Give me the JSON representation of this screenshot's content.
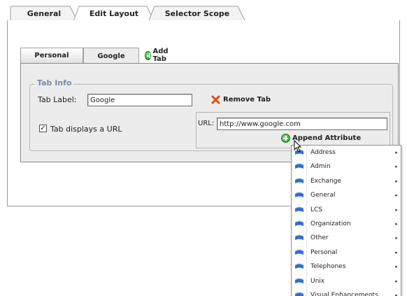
{
  "top_tabs": [
    {
      "label": "General",
      "active": false
    },
    {
      "label": "Edit Layout",
      "active": true
    },
    {
      "label": "Selector Scope",
      "active": false
    }
  ],
  "inner_tabs": [
    {
      "label": "Personal",
      "active": false
    },
    {
      "label": "Google",
      "active": true
    }
  ],
  "add_tab_label": "Add Tab",
  "tab_info": {
    "legend": "Tab Info",
    "tab_label_caption": "Tab Label:",
    "tab_label_value": "Google",
    "remove_tab_label": "Remove Tab",
    "checkbox_label": "Tab displays a URL",
    "checkbox_checked": true,
    "url_caption": "URL:",
    "url_value": "http://www.google.com",
    "append_attribute_label": "Append Attribute"
  },
  "menu_items": [
    {
      "label": "Address",
      "icon": "attribute-category-icon"
    },
    {
      "label": "Admin",
      "icon": "attribute-category-icon"
    },
    {
      "label": "Exchange",
      "icon": "attribute-category-icon"
    },
    {
      "label": "General",
      "icon": "attribute-category-icon"
    },
    {
      "label": "LCS",
      "icon": "attribute-category-icon"
    },
    {
      "label": "Organization",
      "icon": "attribute-category-icon"
    },
    {
      "label": "Other",
      "icon": "attribute-category-icon"
    },
    {
      "label": "Personal",
      "icon": "attribute-category-icon"
    },
    {
      "label": "Telephones",
      "icon": "attribute-category-icon"
    },
    {
      "label": "Unix",
      "icon": "attribute-category-icon"
    },
    {
      "label": "Visual Enhancements",
      "icon": "attribute-category-icon"
    }
  ],
  "colors": {
    "legend_text": "#7c8aa8",
    "add_icon": "#1c9a1c",
    "remove_icon": "#e24a1a",
    "menu_icon": "#2f6fd0"
  }
}
